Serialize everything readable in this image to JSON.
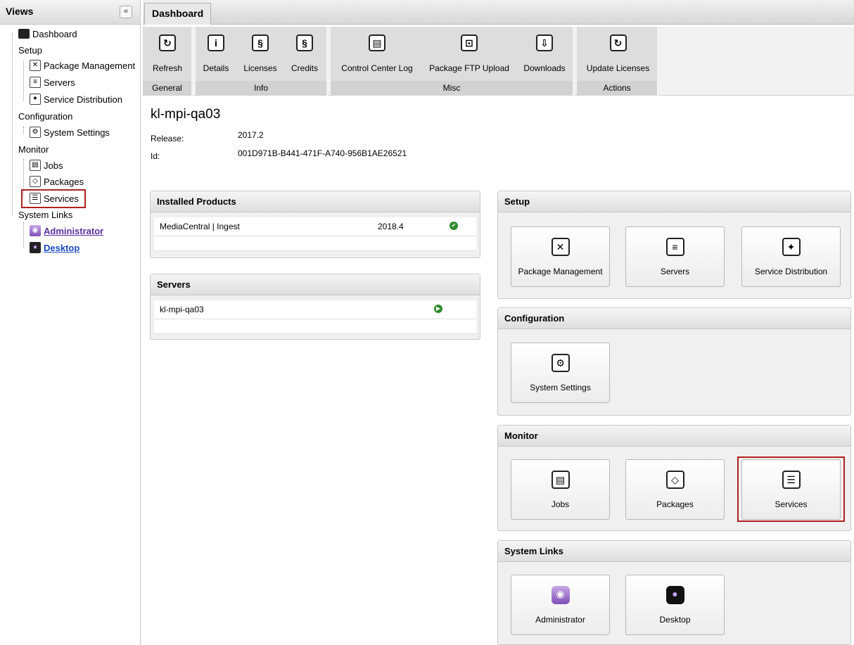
{
  "sidebar": {
    "title": "Views",
    "collapse_glyph": "«",
    "tree": {
      "dashboard": "Dashboard",
      "setup": "Setup",
      "package_management": "Package Management",
      "servers": "Servers",
      "service_distribution": "Service Distribution",
      "configuration": "Configuration",
      "system_settings": "System Settings",
      "monitor": "Monitor",
      "jobs": "Jobs",
      "packages": "Packages",
      "services": "Services",
      "system_links": "System Links",
      "administrator": "Administrator",
      "desktop": "Desktop"
    }
  },
  "tabs": {
    "dashboard": "Dashboard"
  },
  "ribbon": {
    "groups": {
      "general": "General",
      "info": "Info",
      "misc": "Misc",
      "actions": "Actions"
    },
    "buttons": {
      "refresh": "Refresh",
      "details": "Details",
      "licenses": "Licenses",
      "credits": "Credits",
      "control_center_log": "Control Center Log",
      "package_ftp_upload": "Package FTP Upload",
      "downloads": "Downloads",
      "update_licenses": "Update Licenses"
    },
    "icons": {
      "refresh": "refresh-icon",
      "details": "info-icon",
      "licenses": "section-icon",
      "credits": "section-icon",
      "control_center_log": "log-icon",
      "package_ftp_upload": "ftp-upload-icon",
      "downloads": "download-icon",
      "update_licenses": "refresh-icon"
    }
  },
  "host": {
    "name": "kl-mpi-qa03",
    "release_label": "Release:",
    "release_value": "2017.2",
    "id_label": "Id:",
    "id_value": "001D971B-B441-471F-A740-956B1AE26521"
  },
  "installed_products": {
    "title": "Installed Products",
    "rows": [
      {
        "name": "MediaCentral | Ingest",
        "version": "2018.4",
        "status": "ok"
      }
    ]
  },
  "servers_panel": {
    "title": "Servers",
    "rows": [
      {
        "name": "kl-mpi-qa03",
        "status": "running"
      }
    ]
  },
  "setup_panel": {
    "title": "Setup",
    "tiles": {
      "package_management": "Package Management",
      "servers": "Servers",
      "service_distribution": "Service Distribution"
    }
  },
  "configuration_panel": {
    "title": "Configuration",
    "tiles": {
      "system_settings": "System Settings"
    }
  },
  "monitor_panel": {
    "title": "Monitor",
    "tiles": {
      "jobs": "Jobs",
      "packages": "Packages",
      "services": "Services"
    }
  },
  "system_links_panel": {
    "title": "System Links",
    "tiles": {
      "administrator": "Administrator",
      "desktop": "Desktop"
    }
  },
  "colors": {
    "highlight": "#b02020",
    "status_green": "#2e8b2e",
    "link_purple": "#5a2fa0",
    "link_blue": "#1848c0"
  }
}
